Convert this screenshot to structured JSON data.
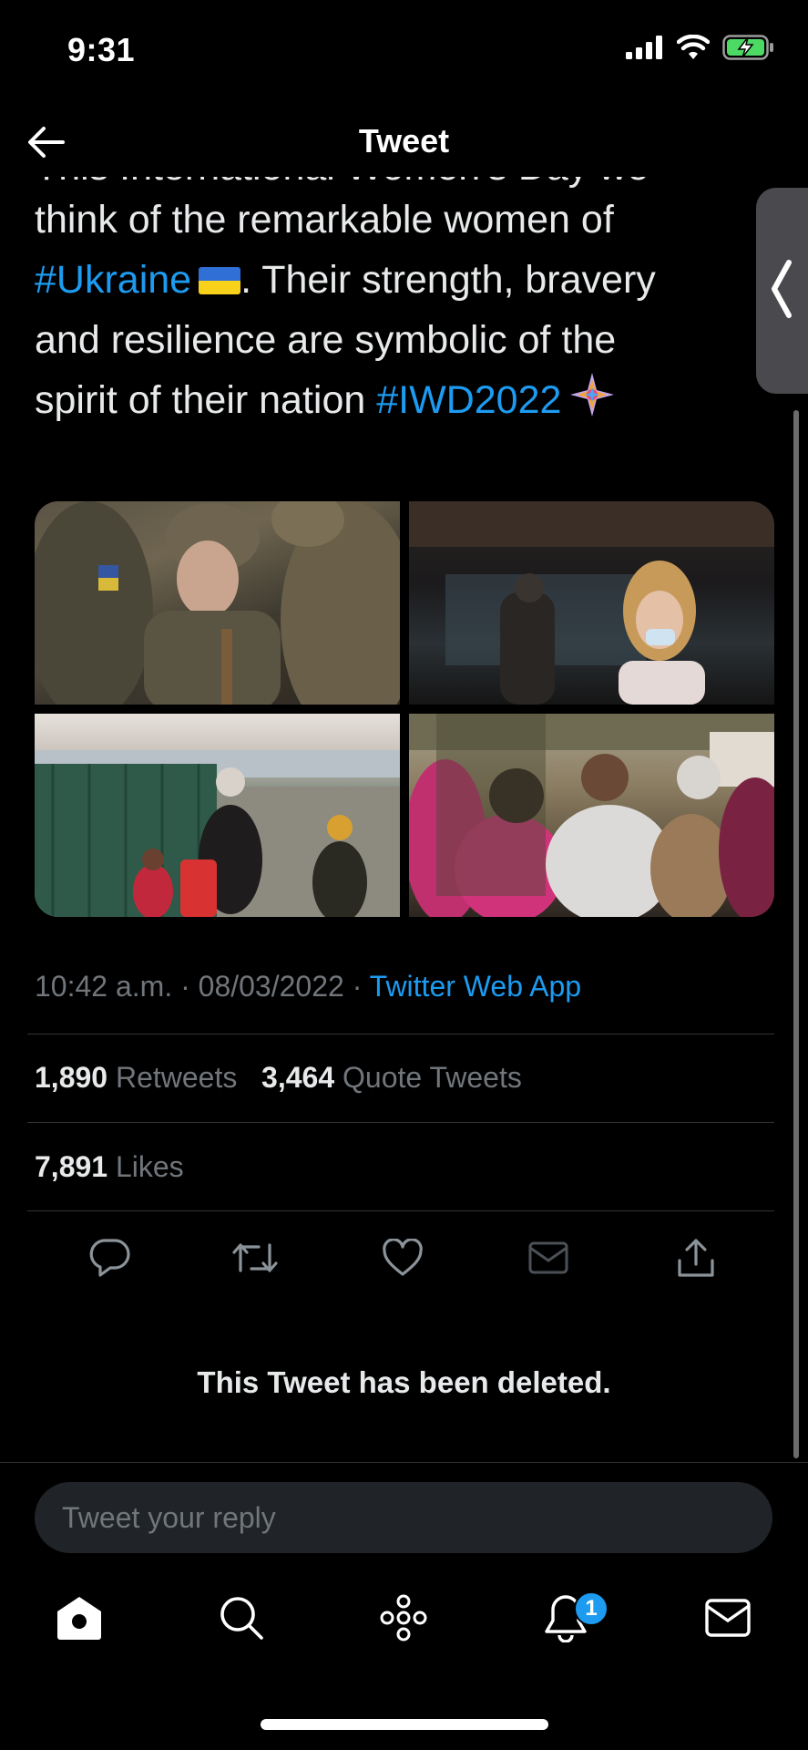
{
  "status_bar": {
    "time": "9:31"
  },
  "header": {
    "title": "Tweet"
  },
  "tweet": {
    "partial_line": "This International Women's Day we",
    "line1": "think of the remarkable women of",
    "hashtag_ukraine": "#Ukraine",
    "line2_rest": ". Their strength, bravery",
    "line3": "and resilience are symbolic of the",
    "line4_pre": "spirit of their nation ",
    "hashtag_iwd": "#IWD2022"
  },
  "meta": {
    "time": "10:42 a.m.",
    "date": "08/03/2022",
    "separator": " · ",
    "source": "Twitter Web App"
  },
  "stats": {
    "retweets_count": "1,890",
    "retweets_label": "Retweets",
    "quotes_count": "3,464",
    "quotes_label": "Quote Tweets",
    "likes_count": "7,891",
    "likes_label": "Likes"
  },
  "actions": [
    "reply-icon",
    "retweet-icon",
    "like-icon",
    "message-icon",
    "share-icon"
  ],
  "deleted_notice": "This Tweet has been deleted.",
  "reply": {
    "placeholder": "Tweet your reply"
  },
  "tabbar": {
    "items": [
      "home-icon",
      "search-icon",
      "spaces-icon",
      "notifications-icon",
      "messages-icon"
    ],
    "notification_count": "1"
  },
  "colors": {
    "accent": "#1d9bf0",
    "background": "#000000",
    "muted": "#71767b"
  }
}
